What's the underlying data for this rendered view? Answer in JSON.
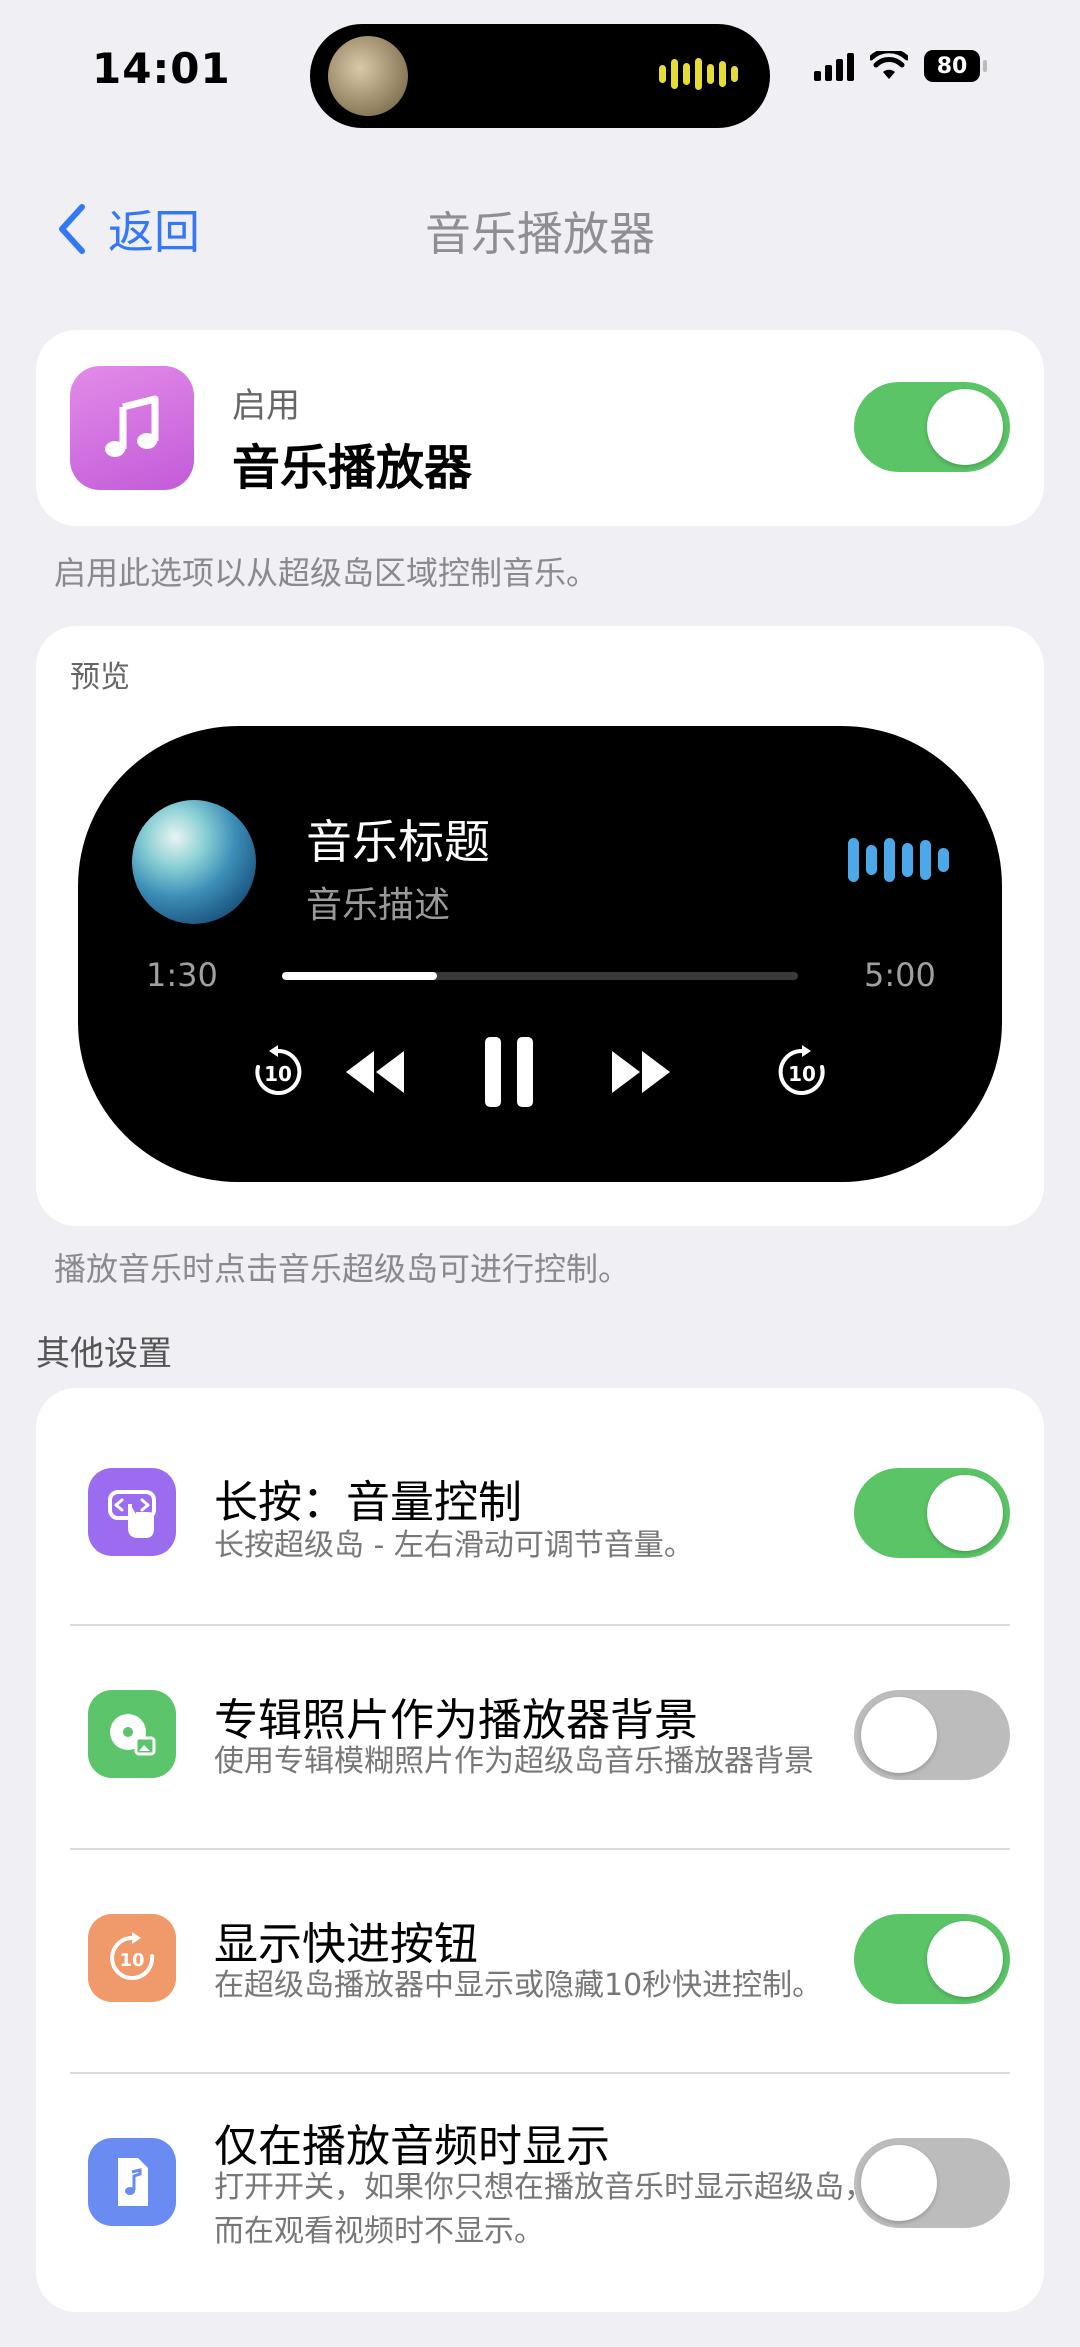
{
  "status_bar": {
    "time": "14:01",
    "battery": "80"
  },
  "nav": {
    "back_label": "返回",
    "title": "音乐播放器"
  },
  "enable_card": {
    "subtitle": "启用",
    "title": "音乐播放器",
    "enabled": true
  },
  "enable_footnote": "启用此选项以从超级岛区域控制音乐。",
  "preview": {
    "label": "预览",
    "song_title": "音乐标题",
    "song_desc": "音乐描述",
    "elapsed": "1:30",
    "duration": "5:00",
    "progress": 0.3
  },
  "preview_footnote": "播放音乐时点击音乐超级岛可进行控制。",
  "other_settings": {
    "label": "其他设置",
    "items": [
      {
        "title": "长按：音量控制",
        "desc": "长按超级岛 - 左右滑动可调节音量。",
        "enabled": true,
        "icon": "hand-gesture-icon",
        "color": "#9b6bf0"
      },
      {
        "title": "专辑照片作为播放器背景",
        "desc": "使用专辑模糊照片作为超级岛音乐播放器背景",
        "enabled": false,
        "icon": "album-photo-icon",
        "color": "#5cc46b"
      },
      {
        "title": "显示快进按钮",
        "desc": "在超级岛播放器中显示或隐藏10秒快进控制。",
        "enabled": true,
        "icon": "skip-10-icon",
        "color": "#f0996a"
      },
      {
        "title": "仅在播放音频时显示",
        "desc": "打开开关，如果你只想在播放音乐时显示超级岛，而在观看视频时不显示。",
        "enabled": false,
        "icon": "music-file-icon",
        "color": "#6a8cf2"
      }
    ]
  },
  "colors": {
    "accent": "#3478f6",
    "toggle_on": "#5ac466",
    "toggle_off": "#bcbcbc"
  }
}
